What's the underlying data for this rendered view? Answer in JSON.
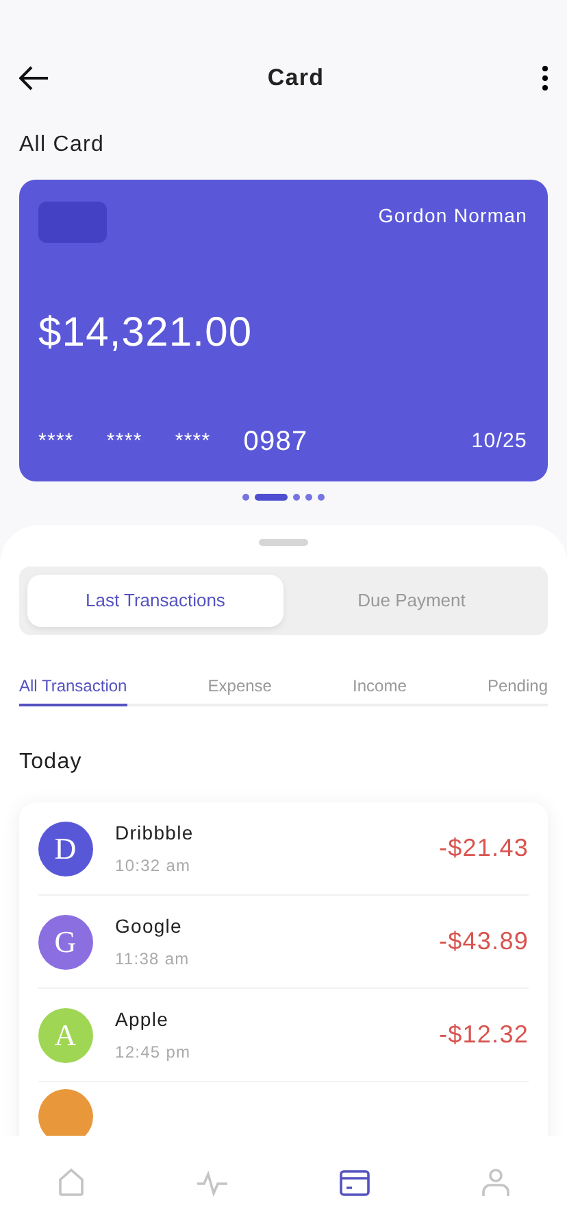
{
  "header": {
    "title": "Card"
  },
  "section_title": "All Card",
  "card": {
    "holder": "Gordon Norman",
    "balance": "$14,321.00",
    "number_groups": [
      "****",
      "****",
      "****",
      "0987"
    ],
    "expiry": "10/25"
  },
  "pager": [
    {
      "selected": false
    },
    {
      "selected": true
    },
    {
      "selected": false
    },
    {
      "selected": false
    },
    {
      "selected": false
    }
  ],
  "segments": [
    {
      "label": "Last Transactions",
      "selected": true
    },
    {
      "label": "Due Payment",
      "selected": false
    }
  ],
  "tabs": [
    {
      "label": "All Transaction",
      "selected": true
    },
    {
      "label": "Expense",
      "selected": false
    },
    {
      "label": "Income",
      "selected": false
    },
    {
      "label": "Pending",
      "selected": false
    }
  ],
  "day_title": "Today",
  "transactions": [
    {
      "initial": "D",
      "color": "#5857d8",
      "name": "Dribbble",
      "time": "10:32 am",
      "amount": "-$21.43"
    },
    {
      "initial": "G",
      "color": "#8b6fe0",
      "name": "Google",
      "time": "11:38 am",
      "amount": "-$43.89"
    },
    {
      "initial": "A",
      "color": "#9fd653",
      "name": "Apple",
      "time": "12:45 pm",
      "amount": "-$12.32"
    },
    {
      "color": "#e8973a"
    }
  ],
  "bottom_nav": [
    {
      "kind": "home",
      "selected": false
    },
    {
      "kind": "activity",
      "selected": false
    },
    {
      "kind": "card",
      "selected": true
    },
    {
      "kind": "profile",
      "selected": false
    }
  ]
}
